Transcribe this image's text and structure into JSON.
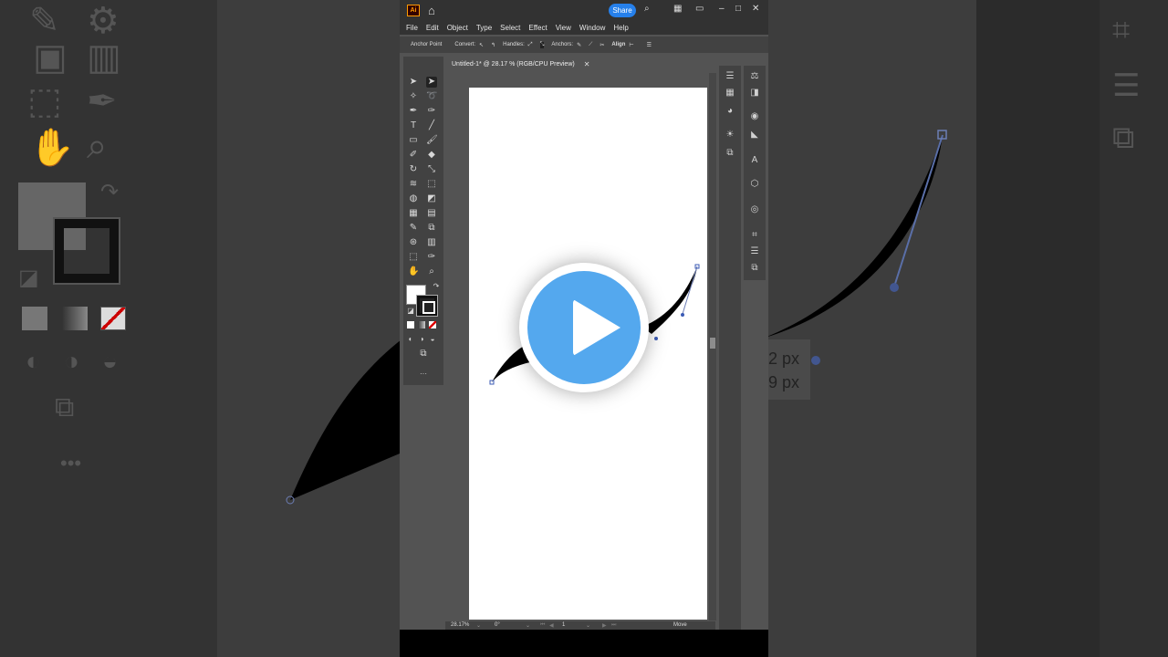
{
  "app": {
    "logo": "Ai",
    "share_label": "Share",
    "menu": [
      "File",
      "Edit",
      "Object",
      "Type",
      "Select",
      "Effect",
      "View",
      "Window",
      "Help"
    ],
    "control_bar": {
      "anchor_point": "Anchor Point",
      "convert": "Convert:",
      "handles": "Handles:",
      "anchors": "Anchors:",
      "align": "Align"
    },
    "document_tab": "Untitled-1* @ 28.17 % (RGB/CPU Preview)",
    "status": {
      "zoom": "28.17%",
      "rotation": "0°",
      "artboard": "1",
      "tool": "Move"
    }
  },
  "background": {
    "labels": [
      "2 px",
      "9 px"
    ]
  },
  "colors": {
    "accent": "#2680eb",
    "play_button": "#54a8ee",
    "ui_dark": "#323232",
    "ui_panel": "#424242",
    "ui_bg": "#535353"
  },
  "icons": {
    "home": "home-icon",
    "search": "search-icon",
    "play": "play-icon"
  }
}
